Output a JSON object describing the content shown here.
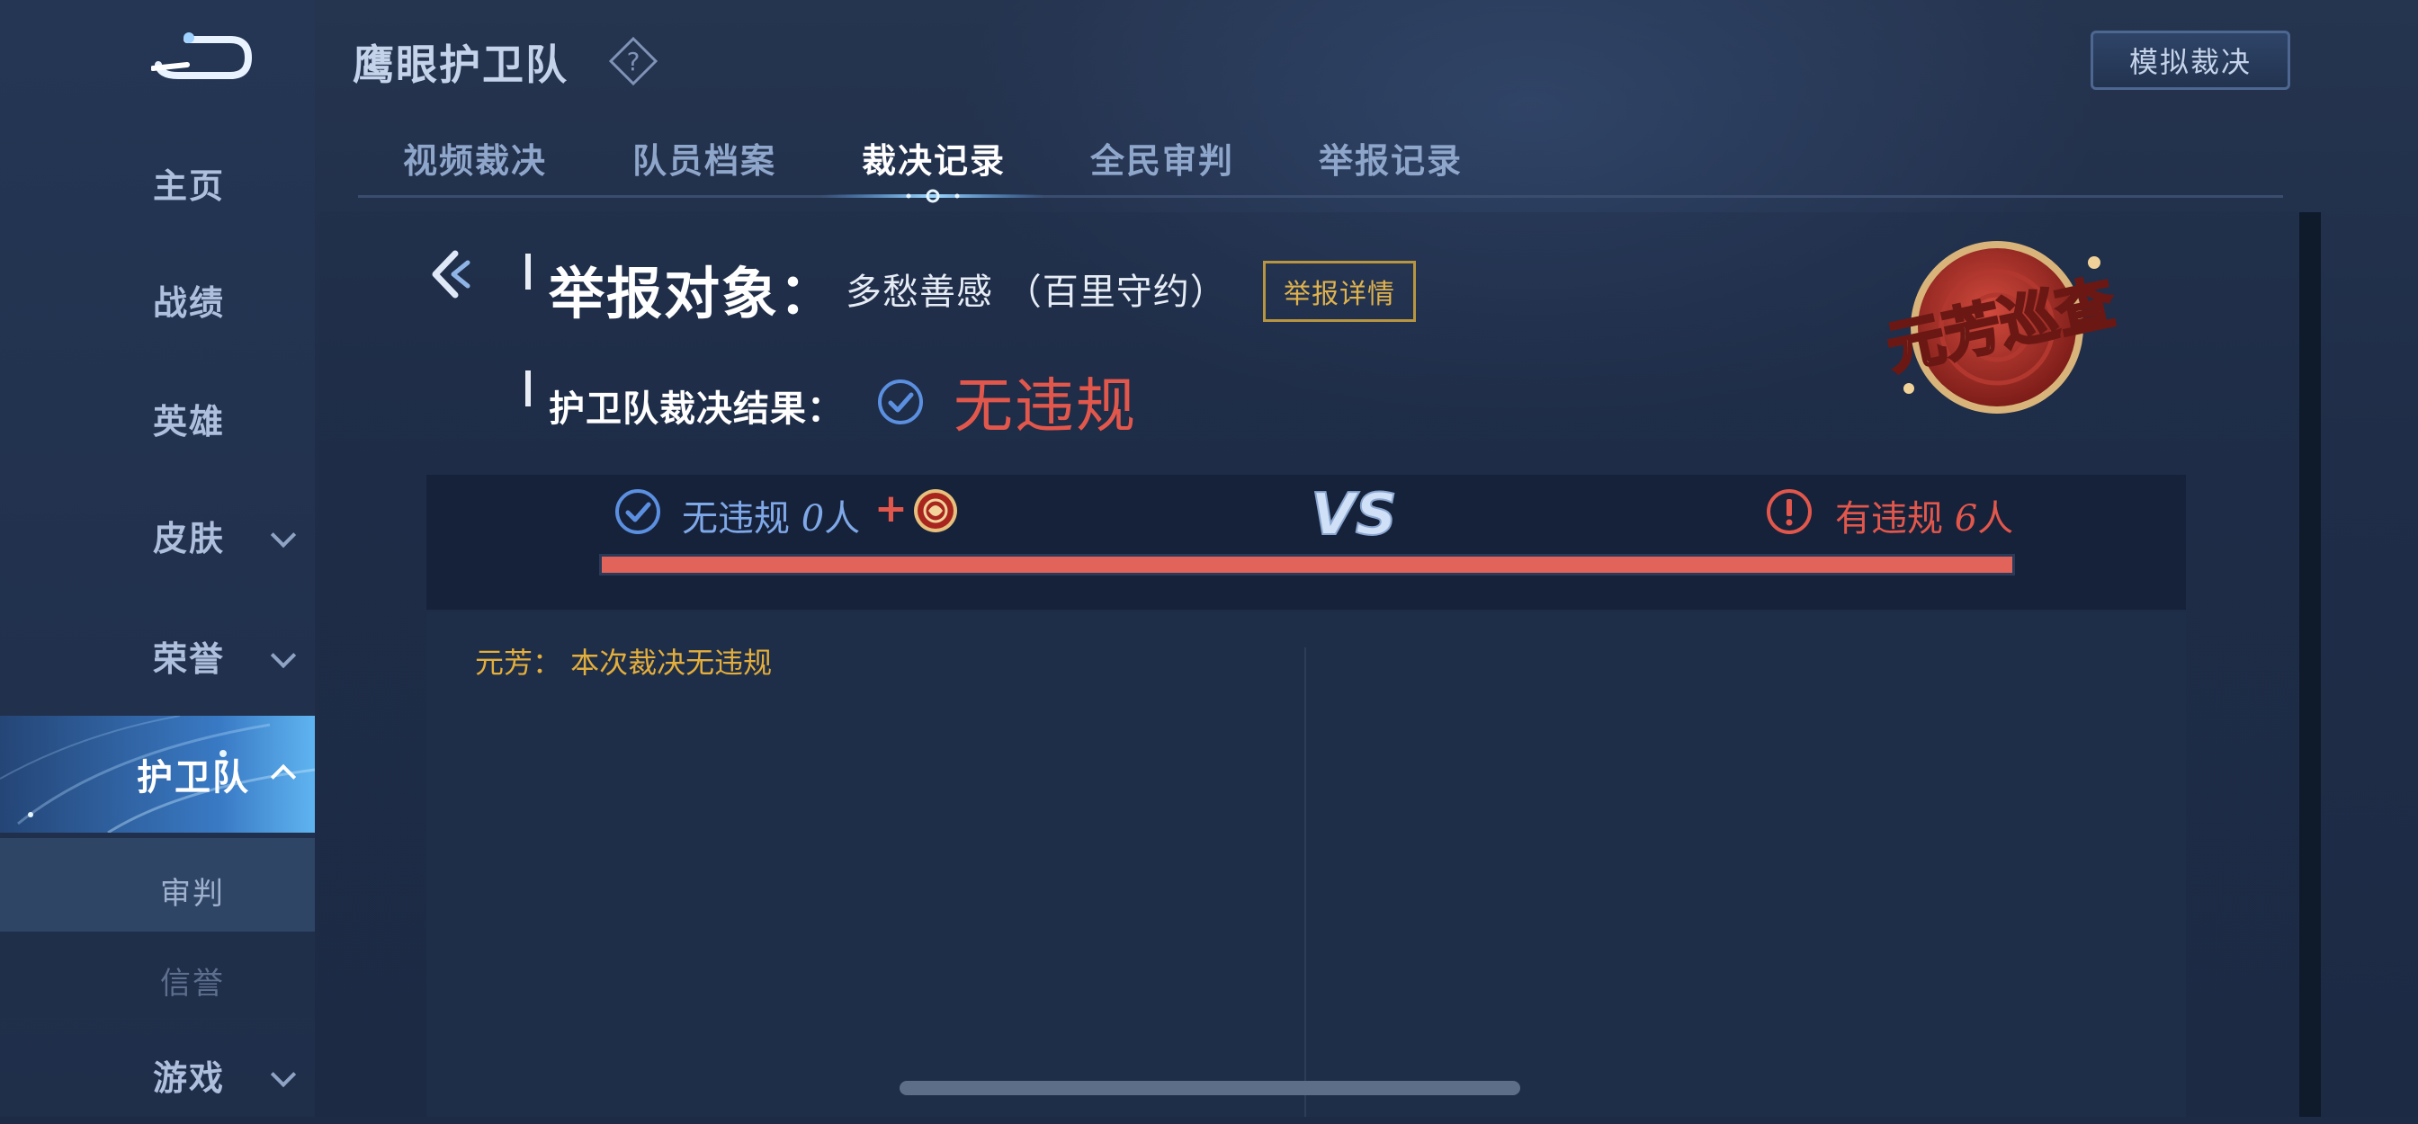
{
  "header": {
    "title": "鹰眼护卫队",
    "help_icon": "question-diamond-icon",
    "simulate_button": "模拟裁决"
  },
  "tabs": [
    {
      "label": "视频裁决",
      "active": false
    },
    {
      "label": "队员档案",
      "active": false
    },
    {
      "label": "裁决记录",
      "active": true
    },
    {
      "label": "全民审判",
      "active": false
    },
    {
      "label": "举报记录",
      "active": false
    }
  ],
  "sidebar": {
    "back_icon": "back-return-icon",
    "items": [
      {
        "label": "主页"
      },
      {
        "label": "战绩"
      },
      {
        "label": "英雄"
      },
      {
        "label": "皮肤"
      },
      {
        "label": "荣誉"
      },
      {
        "label": "护卫队"
      },
      {
        "label": "审判"
      },
      {
        "label": "信誉"
      },
      {
        "label": "游戏"
      }
    ]
  },
  "report": {
    "target_label": "举报对象：",
    "target_name": "多愁善感 （百里守约）",
    "detail_button": "举报详情",
    "result_label": "护卫队裁决结果：",
    "result_value": "无违规",
    "badge_text": "元芳巡查"
  },
  "vote": {
    "left_label": "无违规 ",
    "left_count": "0",
    "left_unit": "人",
    "plus": "+",
    "vs": "VS",
    "right_label": "有违规 ",
    "right_count": "6",
    "right_unit": "人",
    "violation_fraction": 1.0
  },
  "comment": "元芳：  本次裁决无违规",
  "colors": {
    "accent_red": "#e2574c",
    "accent_gold": "#e3ae3c",
    "accent_blue": "#7fa8e8"
  }
}
